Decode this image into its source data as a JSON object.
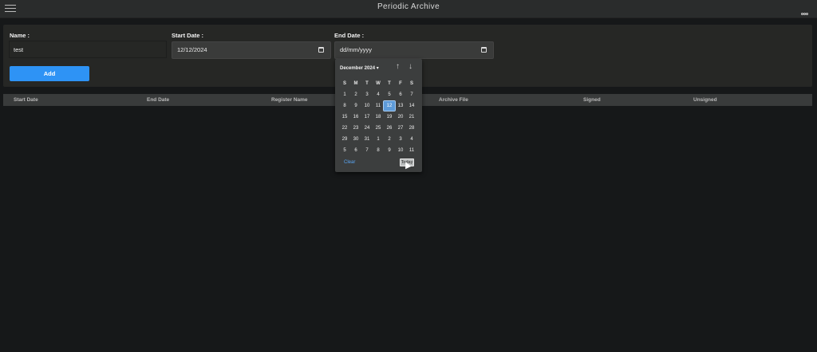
{
  "app": {
    "title": "Periodic Archive"
  },
  "form": {
    "name_label": "Name :",
    "name_value": "test",
    "start_label": "Start Date :",
    "start_value": "12/12/2024",
    "end_label": "End Date :",
    "end_placeholder": "dd/mm/yyyy",
    "add_label": "Add"
  },
  "table": {
    "columns": [
      "Start Date",
      "End Date",
      "Register Name",
      "Archive File",
      "Signed",
      "Unsigned"
    ]
  },
  "datepicker": {
    "month_label": "December 2024 ▾",
    "up_arrow": "↑",
    "down_arrow": "↓",
    "weekdays": [
      "S",
      "M",
      "T",
      "W",
      "T",
      "F",
      "S"
    ],
    "weeks": [
      [
        "1",
        "2",
        "3",
        "4",
        "5",
        "6",
        "7"
      ],
      [
        "8",
        "9",
        "10",
        "11",
        "12",
        "13",
        "14"
      ],
      [
        "15",
        "16",
        "17",
        "18",
        "19",
        "20",
        "21"
      ],
      [
        "22",
        "23",
        "24",
        "25",
        "26",
        "27",
        "28"
      ],
      [
        "29",
        "30",
        "31",
        "1",
        "2",
        "3",
        "4"
      ],
      [
        "5",
        "6",
        "7",
        "8",
        "9",
        "10",
        "11"
      ]
    ],
    "selected_day": "12",
    "clear_label": "Clear",
    "today_label": "Today"
  },
  "colors": {
    "accent": "#2e93f5",
    "selected_day": "#5d9bd9",
    "link": "#5aa6f3"
  },
  "icons": {
    "menu": "hamburger-icon",
    "more": "more-icon",
    "calendar": "calendar-icon"
  }
}
